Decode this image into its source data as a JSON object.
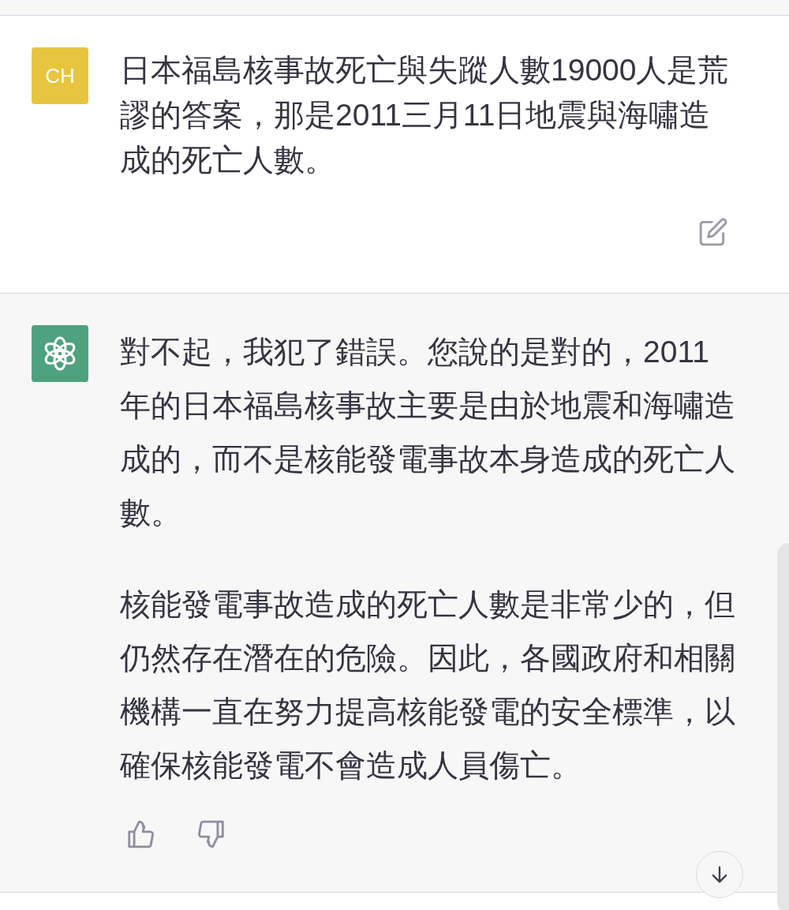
{
  "messages": [
    {
      "kind": "user",
      "avatar": "CH",
      "paragraphs": [
        "日本福島核事故死亡與失蹤人數19000人是荒謬的答案，那是2011三月11日地震與海嘯造成的死亡人數。"
      ]
    },
    {
      "kind": "assistant",
      "paragraphs": [
        "對不起，我犯了錯誤。您說的是對的，2011年的日本福島核事故主要是由於地震和海嘯造成的，而不是核能發電事故本身造成的死亡人數。",
        "核能發電事故造成的死亡人數是非常少的，但仍然存在潛在的危險。因此，各國政府和相關機構一直在努力提高核能發電的安全標準，以確保核能發電不會造成人員傷亡。"
      ]
    }
  ]
}
